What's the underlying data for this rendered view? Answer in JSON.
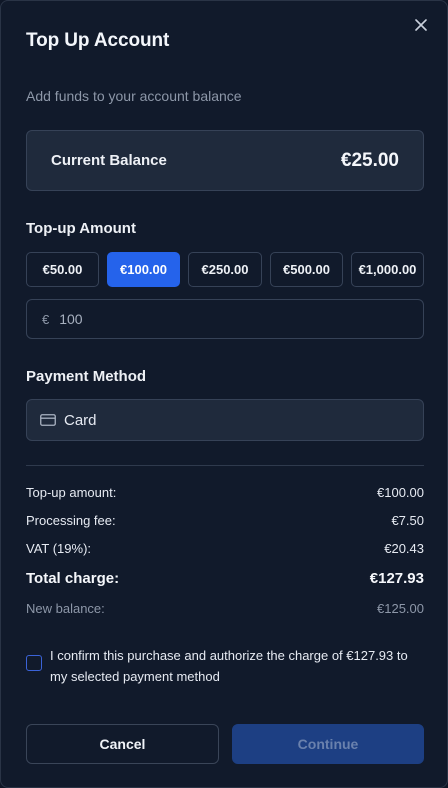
{
  "dialog": {
    "title": "Top Up Account",
    "subtitle": "Add funds to your account balance"
  },
  "balance": {
    "label": "Current Balance",
    "value": "€25.00"
  },
  "topup": {
    "section_label": "Top-up Amount",
    "presets": [
      {
        "label": "€50.00",
        "selected": false
      },
      {
        "label": "€100.00",
        "selected": true
      },
      {
        "label": "€250.00",
        "selected": false
      },
      {
        "label": "€500.00",
        "selected": false
      },
      {
        "label": "€1,000.00",
        "selected": false
      }
    ],
    "currency_symbol": "€",
    "input_value": "100"
  },
  "payment": {
    "section_label": "Payment Method",
    "selected": "Card",
    "icon": "credit-card-icon"
  },
  "summary": {
    "rows": [
      {
        "label": "Top-up amount:",
        "value": "€100.00"
      },
      {
        "label": "Processing fee:",
        "value": "€7.50"
      },
      {
        "label": "VAT (19%):",
        "value": "€20.43"
      },
      {
        "label": "Total charge:",
        "value": "€127.93"
      },
      {
        "label": "New balance:",
        "value": "€125.00"
      }
    ]
  },
  "confirm": {
    "text": "I confirm this purchase and authorize the charge of €127.93 to my selected payment method",
    "checked": false
  },
  "actions": {
    "cancel_label": "Cancel",
    "continue_label": "Continue",
    "continue_disabled": true
  },
  "colors": {
    "accent": "#2563eb",
    "background": "#111a2b",
    "card": "#1f2a3c",
    "muted_text": "#8d97a8"
  }
}
